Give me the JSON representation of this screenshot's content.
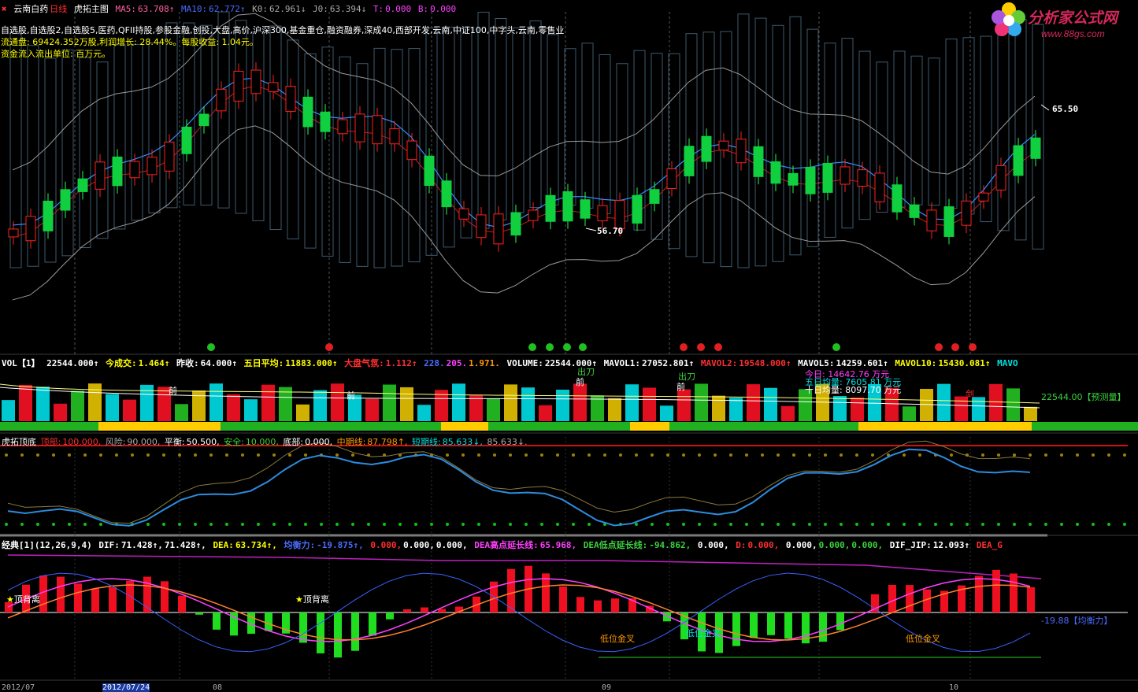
{
  "main_header": {
    "icon": "x-icon",
    "stock_name": "云南白药",
    "period": "日线",
    "indicator": "虎拓主图",
    "ma5_label": "MA5:",
    "ma5_value": "63.708↑",
    "ma10_label": "MA10:",
    "ma10_value": "62.772↑",
    "k0_label": "K0:",
    "k0_value": "62.961↓",
    "j0_label": "J0:",
    "j0_value": "63.394↓",
    "t_label": "T:",
    "t_value": "0.000",
    "b_label": "B:",
    "b_value": "0.000"
  },
  "info_lines": {
    "sectors": "自选股,自选股2,自选股5,医药,QFII持股,参股金融,创投,大盘,高价,沪深300,基金重仓,融资融券,深成40,西部开发,云南,中证100,中字头,云南,零售业",
    "float": "流通盘: 69424.352万股,利润增长: 28.44%。每股收益: 1.04元。",
    "fund": "资金流入流出单位: 百万元。"
  },
  "logo": {
    "title": "分析家公式网",
    "url": "www.88gs.com"
  },
  "price_labels": {
    "high": "65.50",
    "low": "56.70"
  },
  "vol_header": {
    "name": "VOL【1】",
    "vol": "22544.000↑",
    "today_label": "今成交:",
    "today_value": "1.464↑",
    "prev_label": "昨收:",
    "prev_value": "64.000↑",
    "avg5_label": "五日平均:",
    "avg5_value": "11883.000↑",
    "market_label": "大盘气氛:",
    "market_value": "1.112↑",
    "v1": "228.",
    "v2": "205.",
    "v3": "1.971.",
    "volume_label": "VOLUME:",
    "volume_value": "22544.000↑",
    "mavol1_label": "MAVOL1:",
    "mavol1_value": "27052.801↑",
    "mavol2_label": "MAVOL2:",
    "mavol2_value": "19548.000↑",
    "mavol5_label": "MAVOL5:",
    "mavol5_value": "14259.601↑",
    "mavol10_label": "MAVOL10:",
    "mavol10_value": "15430.081↑",
    "mavo_cut": "MAVO"
  },
  "vol_info": {
    "today": "今日: 14642.76 万元",
    "avg5": "五日均量: 7605.81 万元",
    "avg10": "十日均量: 8097.70 万元",
    "forecast": "22544.00【预测量】"
  },
  "vol_annotations": {
    "chudao": "出刀",
    "qian": "前",
    "jian": "剑"
  },
  "hutuo_header": {
    "name": "虎拓顶底",
    "top_label": "顶部:",
    "top_value": "100.000,",
    "risk_label": "风险:",
    "risk_value": "90.000,",
    "balance_label": "平衡:",
    "balance_value": "50.500,",
    "safe_label": "安全:",
    "safe_value": "10.000,",
    "bottom_label": "底部:",
    "bottom_value": "0.000,",
    "mid_label": "中期线:",
    "mid_value": "87.798↑,",
    "short_label": "短期线:",
    "short_value": "85.633↓,",
    "tail": "85.633↓."
  },
  "macd_header": {
    "name": "经典[1](12,26,9,4)",
    "dif_label": "DIF:",
    "dif_value": "71.428↑,",
    "dif2": "71.428↑,",
    "dea_label": "DEA:",
    "dea_value": "63.734↑,",
    "bal_label": "均衡力:",
    "bal_value": "-19.875↑,",
    "z1": "0.000,",
    "z2": "0.000,",
    "z3": "0.000,",
    "dea_high_label": "DEA高点延长线:",
    "dea_high_value": "65.968,",
    "dea_low_label": "DEA低点延长线:",
    "dea_low_value": "-94.862,",
    "z4": "0.000,",
    "d_label": "D:",
    "d_value": "0.000,",
    "z5": "0.000,",
    "z6": "0.000,",
    "z7": "0.000,",
    "dif_jip_label": "DIF_JIP:",
    "dif_jip_value": "12.093↑",
    "dea_cut": "DEA_G"
  },
  "macd_annotations": {
    "top_divergence": "顶背离",
    "low_golden": "低位金叉",
    "balance_value": "-19.88【均衡力】"
  },
  "dates": {
    "d1": "2012/07",
    "d2": "2012/07/24",
    "d3": "08",
    "d4": "09",
    "d5": "10"
  },
  "colors": {
    "up_candle": "#ff2020",
    "down_candle": "#20ff40",
    "bollinger": "#b0b0b0",
    "ma_blue": "#3a8cff",
    "ma_red": "#ff3030"
  }
}
